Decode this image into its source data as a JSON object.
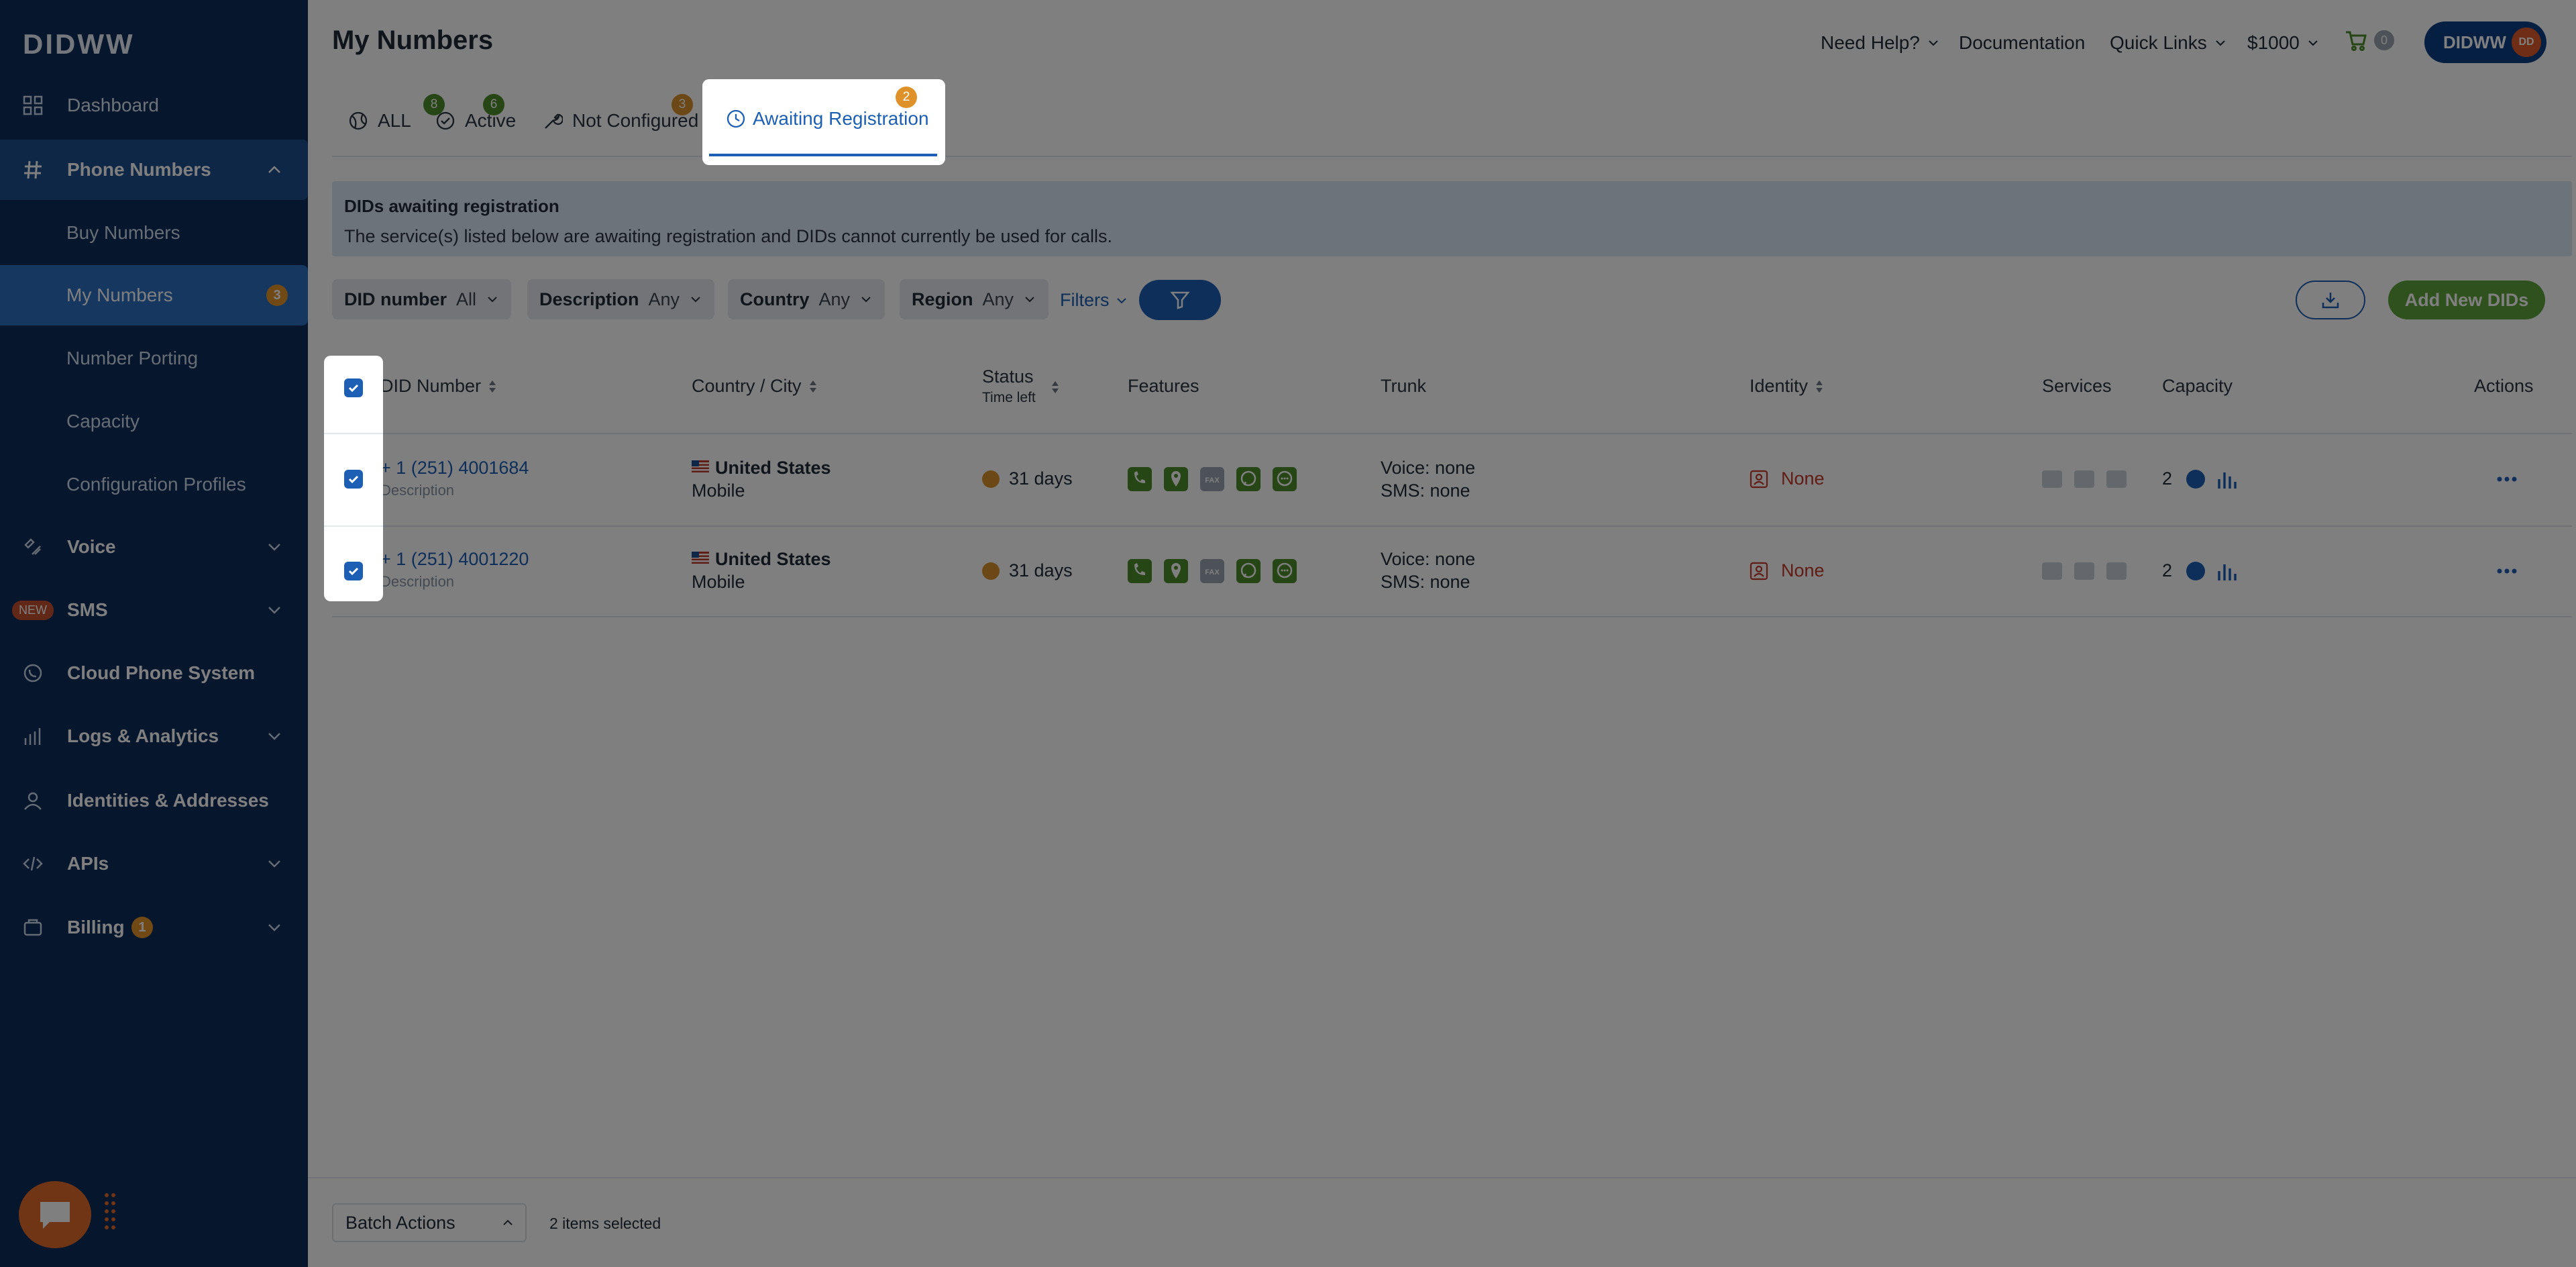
{
  "brand": {
    "logo": "DIDWW"
  },
  "sidebar": {
    "items": [
      {
        "label": "Dashboard",
        "icon": "grid-icon"
      },
      {
        "label": "Phone Numbers",
        "icon": "hash-icon"
      },
      {
        "label": "Voice",
        "icon": "voice-icon"
      },
      {
        "label": "SMS",
        "icon": "sms-icon",
        "badge": "NEW"
      },
      {
        "label": "Cloud Phone System",
        "icon": "phone-circle-icon"
      },
      {
        "label": "Logs & Analytics",
        "icon": "bar-chart-icon"
      },
      {
        "label": "Identities & Addresses",
        "icon": "user-icon"
      },
      {
        "label": "APIs",
        "icon": "code-icon"
      },
      {
        "label": "Billing",
        "icon": "billing-icon",
        "count": "1"
      }
    ],
    "sub_items": [
      {
        "label": "Buy Numbers"
      },
      {
        "label": "My Numbers",
        "count": "3"
      },
      {
        "label": "Number Porting"
      },
      {
        "label": "Capacity"
      },
      {
        "label": "Configuration Profiles"
      }
    ]
  },
  "header": {
    "title": "My Numbers",
    "need_help": "Need Help?",
    "documentation": "Documentation",
    "quick_links": "Quick Links",
    "balance": "$1000",
    "cart_count": "0",
    "account": "DIDWW",
    "avatar": "DD"
  },
  "tabs": [
    {
      "label": "ALL",
      "count": "8"
    },
    {
      "label": "Active",
      "count": "6"
    },
    {
      "label": "Not Configured",
      "count": "3"
    },
    {
      "label": "Awaiting Registration",
      "count": "2"
    }
  ],
  "info": {
    "title": "DIDs awaiting registration",
    "text": "The service(s) listed below are awaiting registration and DIDs cannot currently be used for calls."
  },
  "filters": [
    {
      "key": "DID number",
      "value": "All"
    },
    {
      "key": "Description",
      "value": "Any"
    },
    {
      "key": "Country",
      "value": "Any"
    },
    {
      "key": "Region",
      "value": "Any"
    }
  ],
  "filters_link": "Filters",
  "add_button": "Add New DIDs",
  "table": {
    "columns": {
      "did": "DID Number",
      "country": "Country / City",
      "status": "Status",
      "time_left": "Time left",
      "features": "Features",
      "trunk": "Trunk",
      "identity": "Identity",
      "services": "Services",
      "capacity": "Capacity",
      "actions": "Actions"
    },
    "rows": [
      {
        "number": "+ 1 (251) 4001684",
        "description": "Description",
        "country": "United States",
        "city": "Mobile",
        "status": "31 days",
        "voice": "Voice: none",
        "sms": "SMS: none",
        "identity": "None",
        "capacity": "2"
      },
      {
        "number": "+ 1 (251) 4001220",
        "description": "Description",
        "country": "United States",
        "city": "Mobile",
        "status": "31 days",
        "voice": "Voice: none",
        "sms": "SMS: none",
        "identity": "None",
        "capacity": "2"
      }
    ]
  },
  "footer": {
    "batch_actions": "Batch Actions",
    "selected": "2 items selected"
  },
  "colors": {
    "sidebar": "#0b2d5b",
    "accent": "#1d5fb5",
    "feature_green": "#4c8c2b",
    "status_orange": "#d9912c",
    "identity_red": "#c0392b"
  }
}
